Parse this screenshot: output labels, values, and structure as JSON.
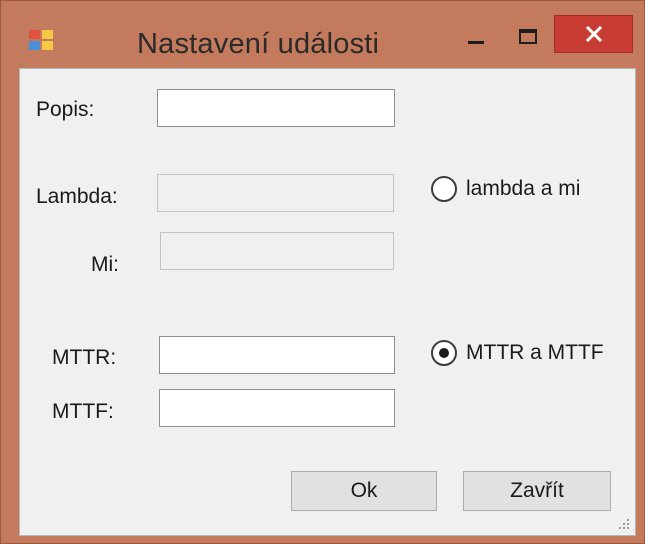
{
  "window": {
    "title": "Nastavení události",
    "colors": {
      "frame": "#c47a5d",
      "close_button": "#c83c33",
      "client_background": "#f0f0f0"
    }
  },
  "form": {
    "popis": {
      "label": "Popis:",
      "value": ""
    },
    "lambda": {
      "label": "Lambda:",
      "value": "",
      "enabled": false
    },
    "mi": {
      "label": "Mi:",
      "value": "",
      "enabled": false
    },
    "mttr": {
      "label": "MTTR:",
      "value": "",
      "enabled": true
    },
    "mttf": {
      "label": "MTTF:",
      "value": "",
      "enabled": true
    },
    "radios": [
      {
        "label": "lambda a mi",
        "checked": false
      },
      {
        "label": "MTTR a MTTF",
        "checked": true
      }
    ]
  },
  "buttons": {
    "ok": "Ok",
    "close": "Zavřít"
  },
  "icons": {
    "app": "app-icon",
    "minimize": "minimize-icon",
    "maximize": "maximize-icon",
    "close": "close-icon",
    "resize": "resize-grip-icon"
  }
}
